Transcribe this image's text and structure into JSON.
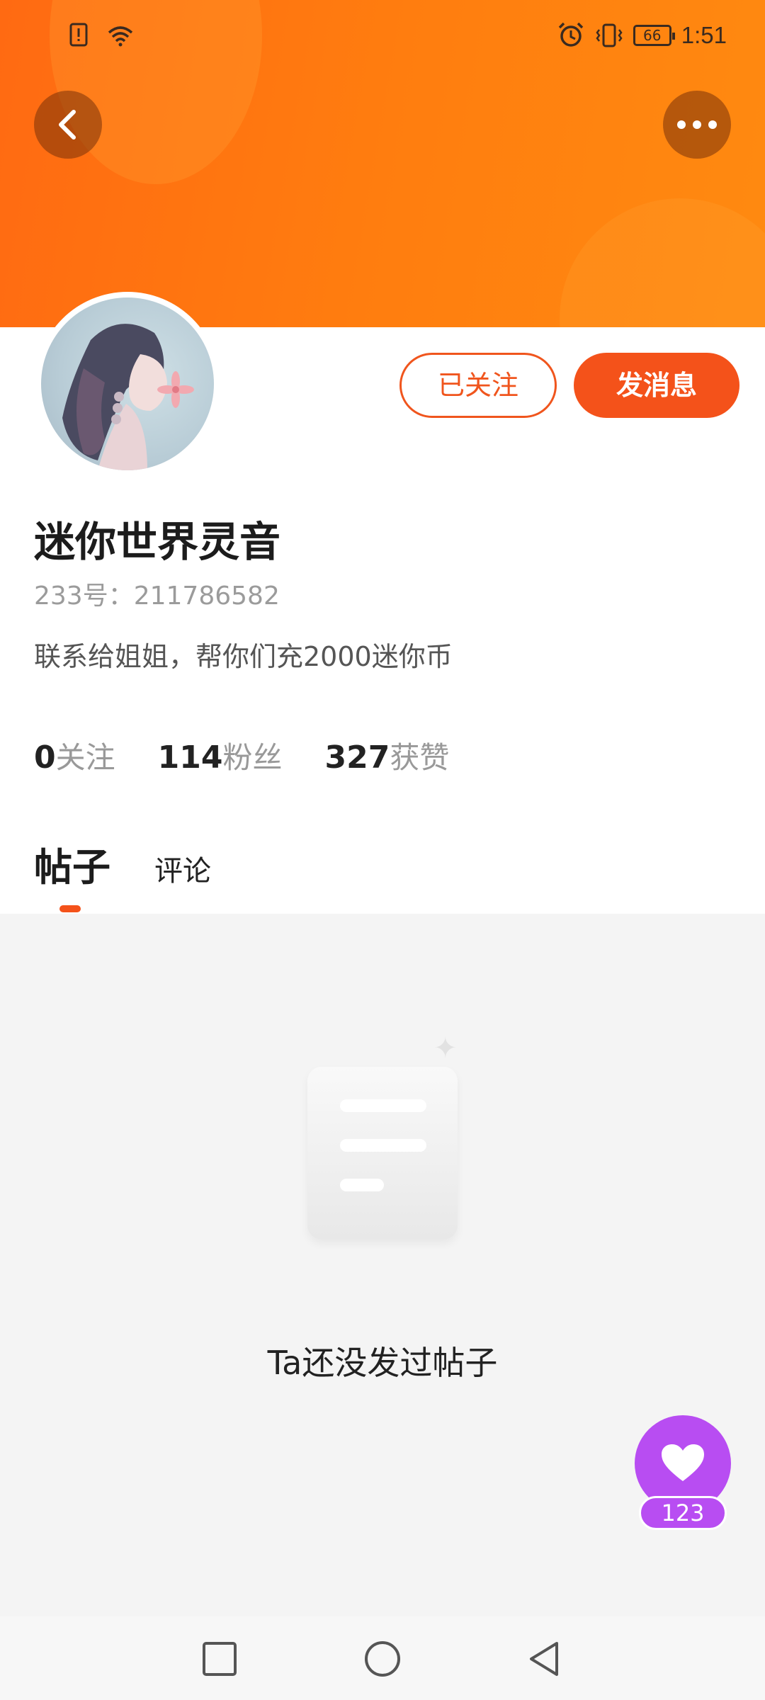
{
  "status_bar": {
    "time": "1:51",
    "battery": "66",
    "icons": [
      "sim-alert-icon",
      "wifi-icon",
      "alarm-icon",
      "vibrate-icon",
      "battery-icon"
    ]
  },
  "header": {
    "back_icon": "chevron-left-icon",
    "more_icon": "more-dots-icon",
    "banner_color": "#ff7710"
  },
  "profile": {
    "name": "迷你世界灵音",
    "uid": "233号：211786582",
    "bio": "联系给姐姐，帮你们充2000迷你币",
    "follow_label": "已关注",
    "message_label": "发消息",
    "stats": [
      {
        "num": "0",
        "label": "关注"
      },
      {
        "num": "114",
        "label": "粉丝"
      },
      {
        "num": "327",
        "label": "获赞"
      }
    ]
  },
  "tabs": {
    "active": "帖子",
    "other": "评论"
  },
  "empty_state": {
    "text": "Ta还没发过帖子",
    "icon": "empty-document-icon"
  },
  "fab": {
    "icon": "heart-icon",
    "count": "123",
    "color": "#b84df2"
  },
  "nav": {
    "icons": [
      "recent-apps-icon",
      "home-icon",
      "back-icon"
    ]
  },
  "colors": {
    "accent": "#f4521a"
  }
}
